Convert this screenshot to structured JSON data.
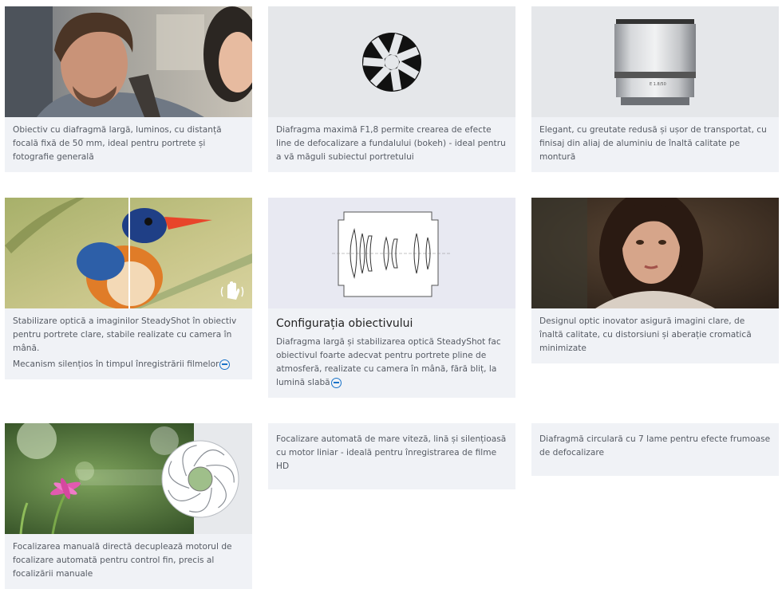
{
  "cards": [
    {
      "text": "Obiectiv cu diafragmă largă, luminos, cu distanță focală fixă de 50 mm, ideal pentru portrete și fotografie generală"
    },
    {
      "text": "Diafragma maximă F1,8 permite crearea de efecte line de defocalizare a fundalului (bokeh) - ideal pentru a vă măguli subiectul portretului"
    },
    {
      "text": "Elegant, cu greutate redusă și ușor de transportat, cu finisaj din aliaj de aluminiu de înaltă calitate pe montură"
    },
    {
      "text": "Stabilizare optică a imaginilor SteadyShot în obiectiv pentru portrete clare, stabile realizate cu camera în mână.",
      "text2": "Mecanism silențios în timpul înregistrării filmelor"
    },
    {
      "title": "Configurația obiectivului",
      "text": "Diafragma largă și stabilizarea optică SteadyShot fac obiectivul foarte adecvat pentru portrete pline de atmosferă, realizate cu camera în mână, fără bliț, la lumină slabă"
    },
    {
      "text": "Designul optic inovator asigură imagini clare, de înaltă calitate, cu distorsiuni și aberație cromatică minimizate"
    },
    {
      "text": "Focalizarea manuală directă decuplează motorul de focalizare automată pentru control fin, precis al focalizării manuale"
    },
    {
      "text": "Focalizare automată de mare viteză, lină și silențioasă cu motor liniar - ideală pentru înregistrarea de filme HD"
    },
    {
      "text": "Diafragmă circulară cu 7 lame pentru efecte frumoase de defocalizare"
    }
  ],
  "icons": {
    "aperture": "aperture-icon",
    "stabilizer": "hand-shake-icon",
    "expand": "minus-circle-icon"
  },
  "colors": {
    "card_bg": "#f0f2f6",
    "accent": "#1a73c8"
  }
}
